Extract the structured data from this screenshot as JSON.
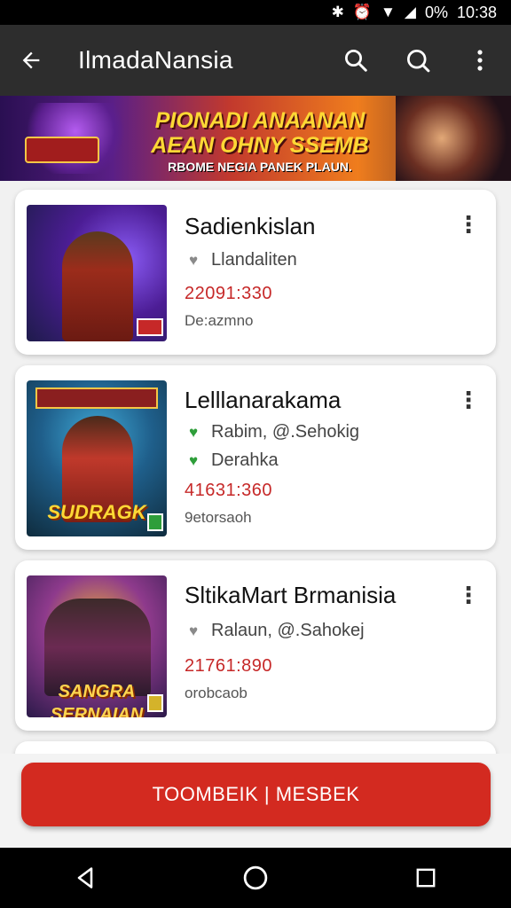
{
  "status": {
    "battery": "0%",
    "time": "10:38"
  },
  "app_bar": {
    "title": "IlmadaNansia"
  },
  "banner": {
    "line1": "PIONADI ANAANAN",
    "line2": "AEAN OHNY SSEMB",
    "line3": "RBOME NEGIA PANEK PLAUN."
  },
  "items": [
    {
      "title": "Sadienkislan",
      "meta1": "Llandaliten",
      "price": "22091:330",
      "sub": "De:azmno"
    },
    {
      "title": "Lelllanarakama",
      "meta1": "Rabim, @.Sehokig",
      "meta2": "Derahka",
      "price": "41631:360",
      "sub": "9etorsaoh",
      "thumb_logo": "SUDRAGK"
    },
    {
      "title": "SltikaMart Brmanisia",
      "meta1": "Ralaun, @.Sahokej",
      "price": "21761:890",
      "sub": "orobcaob",
      "thumb_logo": "SANGRA SERNAIAN"
    }
  ],
  "cta": {
    "label": "TOOMBEIK | MESBEK"
  },
  "colors": {
    "accent": "#d32a20",
    "price": "#c62828",
    "heart_green": "#2e9e3a",
    "heart_gray": "#8a8a8a"
  }
}
